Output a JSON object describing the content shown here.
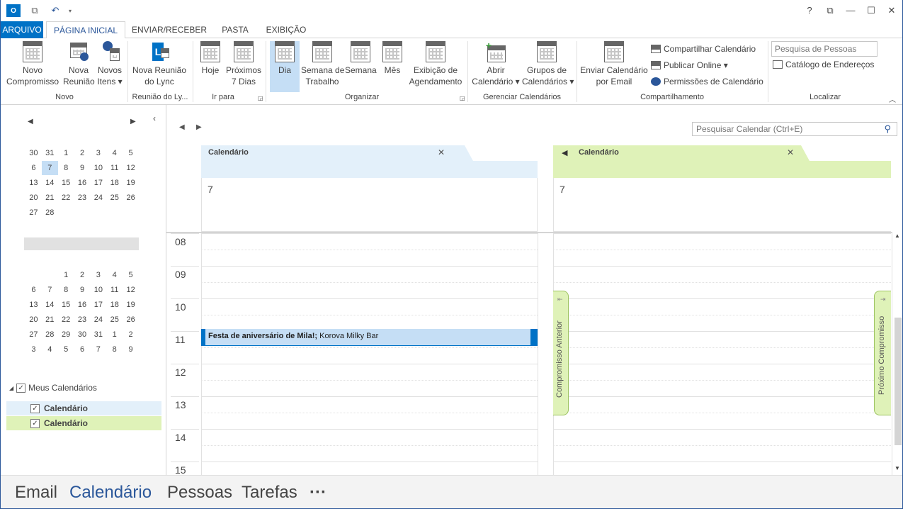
{
  "titlebar": {
    "help": "?",
    "restore": "⧉",
    "min": "—",
    "max": "☐",
    "close": "✕"
  },
  "tabs": {
    "file": "ARQUIVO",
    "home": "PÁGINA INICIAL",
    "sendreceive": "ENVIAR/RECEBER",
    "folder": "PASTA",
    "view": "EXIBIÇÃO"
  },
  "ribbon": {
    "new_appointment": "Novo\nCompromisso",
    "new_meeting": "Nova\nReunião",
    "new_items": "Novos\nItens ▾",
    "group_new": "Novo",
    "lync_meeting": "Nova Reunião\ndo Lync",
    "group_lync": "Reunião do Ly...",
    "today": "Hoje",
    "next7": "Próximos\n7 Dias",
    "group_goto": "Ir para",
    "day": "Dia",
    "workweek": "Semana de\nTrabalho",
    "week": "Semana",
    "month": "Mês",
    "schedule": "Exibição de\nAgendamento",
    "group_arrange": "Organizar",
    "open_calendar": "Abrir\nCalendário ▾",
    "calendar_groups": "Grupos de\nCalendários ▾",
    "group_manage": "Gerenciar Calendários",
    "email_calendar": "Enviar Calendário\npor Email",
    "share_calendar": "Compartilhar Calendário",
    "publish_online": "Publicar Online ▾",
    "calendar_permissions": "Permissões de Calendário",
    "group_share": "Compartilhamento",
    "search_people_placeholder": "Pesquisa de Pessoas",
    "address_book": "Catálogo de Endereços",
    "group_find": "Localizar"
  },
  "minical1": [
    [
      "30",
      "31",
      "1",
      "2",
      "3",
      "4",
      "5"
    ],
    [
      "6",
      "7",
      "8",
      "9",
      "10",
      "11",
      "12"
    ],
    [
      "13",
      "14",
      "15",
      "16",
      "17",
      "18",
      "19"
    ],
    [
      "20",
      "21",
      "22",
      "23",
      "24",
      "25",
      "26"
    ],
    [
      "27",
      "28",
      "",
      "",
      "",
      "",
      ""
    ]
  ],
  "minical2": [
    [
      "",
      "",
      "1",
      "2",
      "3",
      "4",
      "5"
    ],
    [
      "6",
      "7",
      "8",
      "9",
      "10",
      "11",
      "12"
    ],
    [
      "13",
      "14",
      "15",
      "16",
      "17",
      "18",
      "19"
    ],
    [
      "20",
      "21",
      "22",
      "23",
      "24",
      "25",
      "26"
    ],
    [
      "27",
      "28",
      "29",
      "30",
      "31",
      "1",
      "2"
    ],
    [
      "3",
      "4",
      "5",
      "6",
      "7",
      "8",
      "9"
    ]
  ],
  "folders": {
    "group": "Meus Calendários",
    "cal1": "Calendário",
    "cal2": "Calendário",
    "colors": {
      "cal1": "#e3f0fa",
      "cal2": "#dff2b8"
    }
  },
  "calendar": {
    "search_placeholder": "Pesquisar Calendar (Ctrl+E)",
    "pane1": {
      "title": "Calendário",
      "day": "7",
      "color": "#e3f0fa"
    },
    "pane2": {
      "title": "Calendário",
      "day": "7",
      "color": "#dff2b8"
    },
    "hours": [
      "08",
      "09",
      "10",
      "11",
      "12",
      "13",
      "14",
      "15"
    ],
    "event": {
      "title": "Festa de aniversário de Mila!;",
      "location": "Korova Milky Bar"
    },
    "prev_appt": "Compromisso Anterior",
    "next_appt": "Próximo Compromisso"
  },
  "bottomnav": {
    "email": "Email",
    "calendar": "Calendário",
    "people": "Pessoas",
    "tasks": "Tarefas",
    "more": "···"
  }
}
